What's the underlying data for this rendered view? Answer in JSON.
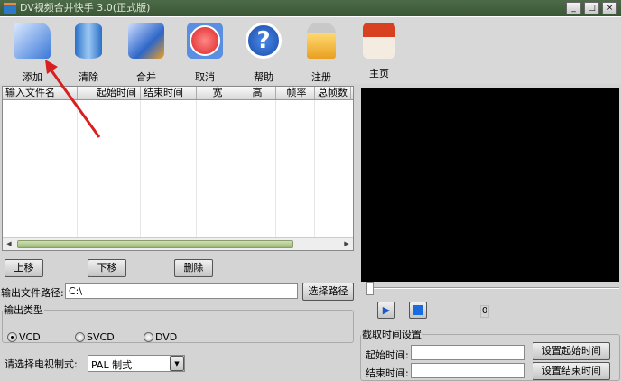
{
  "window": {
    "title": "DV视频合并快手 3.0(正式版)",
    "min": "_",
    "max": "□",
    "close": "×"
  },
  "toolbar": [
    {
      "label": "添加",
      "icon": "folder-open-icon"
    },
    {
      "label": "清除",
      "icon": "trash-icon"
    },
    {
      "label": "合并",
      "icon": "merge-folder-icon"
    },
    {
      "label": "取消",
      "icon": "power-icon"
    },
    {
      "label": "帮助",
      "icon": "help-icon"
    },
    {
      "label": "注册",
      "icon": "lock-icon"
    },
    {
      "label": "主页",
      "icon": "home-icon"
    }
  ],
  "table": {
    "columns": [
      "输入文件名",
      "起始时间",
      "结束时间",
      "宽",
      "高",
      "帧率",
      "总帧数"
    ]
  },
  "list_buttons": {
    "up": "上移",
    "down": "下移",
    "delete": "删除"
  },
  "output": {
    "path_label": "输出文件路径:",
    "path_value": "C:\\",
    "browse": "选择路径",
    "type_legend": "输出类型",
    "types": [
      "VCD",
      "SVCD",
      "DVD"
    ],
    "selected": "VCD",
    "tv_label": "请选择电视制式:",
    "tv_value": "PAL 制式"
  },
  "player": {
    "frame": "0",
    "slider": 0
  },
  "clip": {
    "legend": "截取时间设置",
    "start_label": "起始时间:",
    "end_label": "结束时间:",
    "start_value": "",
    "end_value": "",
    "set_start": "设置起始时间",
    "set_end": "设置结束时间"
  }
}
